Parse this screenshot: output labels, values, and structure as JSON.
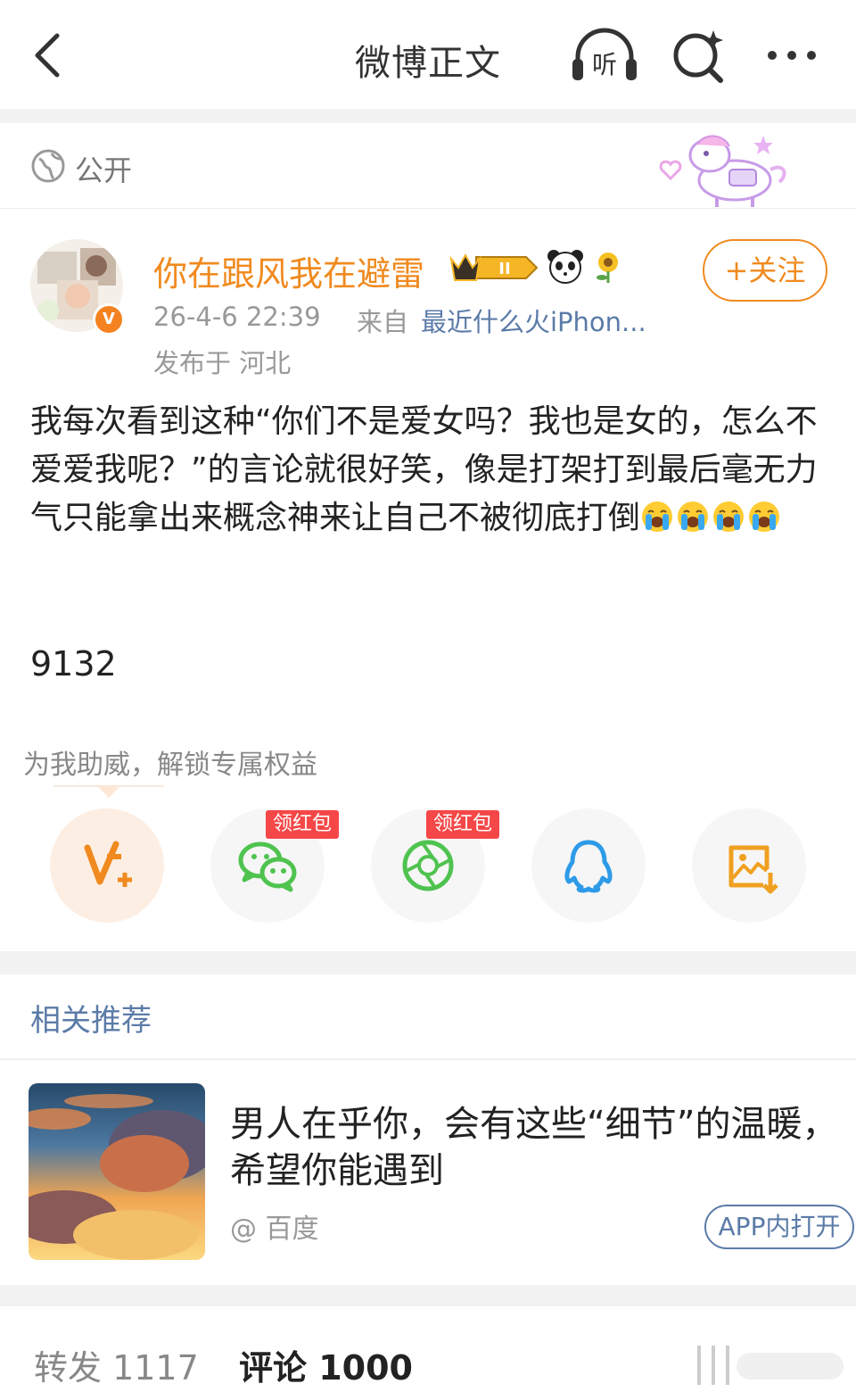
{
  "header": {
    "title": "微博正文",
    "listen_label": "听",
    "icons": [
      "back-arrow-icon",
      "headphones-icon",
      "search-sparkle-icon",
      "more-dots-icon"
    ]
  },
  "visibility": {
    "label": "公开"
  },
  "author": {
    "name": "你在跟风我在避雷",
    "badge_level": "II",
    "follow_label": "+关注",
    "time": "26-4-6 22:39",
    "source_prefix": "来自",
    "source": "最近什么火iPhon...",
    "location": "发布于 河北",
    "verified_mark": "V"
  },
  "post": {
    "text": "我每次看到这种“你们不是爱女吗？我也是女的，怎么不爱爱我呢？”的言论就很好笑，像是打架打到最后毫无力气只能拿出来概念神来让自己不被彻底打倒",
    "emoji": "crying-face",
    "emoji_count": 4,
    "number": "9132"
  },
  "share": {
    "hint": "为我助威，解锁专属权益",
    "redpack_label": "领红包",
    "items": [
      "vip-support",
      "wechat",
      "moments",
      "qq",
      "save-image"
    ]
  },
  "recommend": {
    "title": "相关推荐",
    "item_title": "男人在乎你，会有这些“细节”的温暖，希望你能遇到",
    "item_source": "@ 百度",
    "open_label": "APP内打开"
  },
  "tabs": {
    "repost": "转发 1117",
    "comment": "评论 1000"
  },
  "colors": {
    "accent_orange": "#f08a1f",
    "link_blue": "#5b7ba8",
    "redpack_red": "#f54747",
    "wechat_green": "#4fc34f"
  }
}
